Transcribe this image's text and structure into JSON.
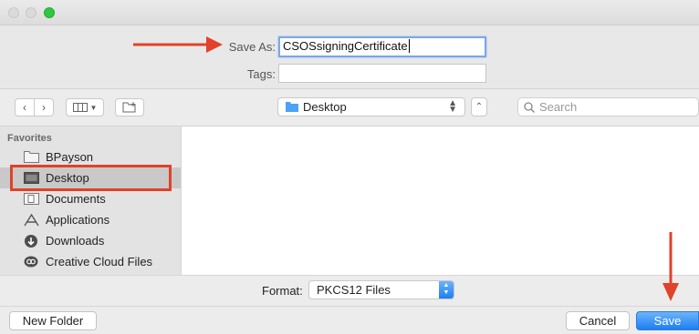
{
  "save": {
    "save_as_label": "Save As:",
    "filename": "CSOSsigningCertificate",
    "tags_label": "Tags:",
    "tags_value": ""
  },
  "toolbar": {
    "location": "Desktop",
    "search_placeholder": "Search"
  },
  "sidebar": {
    "section": "Favorites",
    "items": [
      {
        "label": "BPayson",
        "icon": "folder-icon"
      },
      {
        "label": "Desktop",
        "icon": "desktop-folder-icon",
        "selected": true
      },
      {
        "label": "Documents",
        "icon": "documents-icon"
      },
      {
        "label": "Applications",
        "icon": "applications-icon"
      },
      {
        "label": "Downloads",
        "icon": "downloads-icon"
      },
      {
        "label": "Creative Cloud Files",
        "icon": "creative-cloud-icon"
      }
    ]
  },
  "format": {
    "label": "Format:",
    "value": "PKCS12 Files"
  },
  "buttons": {
    "new_folder": "New Folder",
    "cancel": "Cancel",
    "save": "Save"
  },
  "colors": {
    "accent": "#1d7ff2",
    "annotation": "#e0422a",
    "traffic_green": "#2fc840"
  }
}
